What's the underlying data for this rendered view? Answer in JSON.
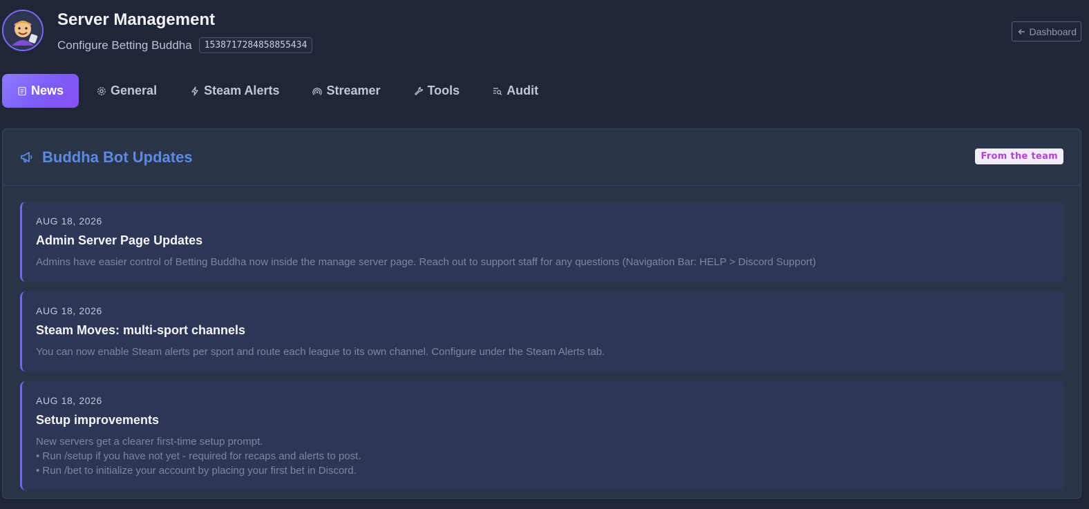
{
  "header": {
    "title": "Server Management",
    "subtitle": "Configure Betting Buddha",
    "server_id": "1538717284858855434",
    "dashboard_label": "Dashboard"
  },
  "tabs": [
    {
      "label": "News",
      "icon": "newspaper-icon",
      "active": true
    },
    {
      "label": "General",
      "icon": "gear-icon",
      "active": false
    },
    {
      "label": "Steam Alerts",
      "icon": "bolt-icon",
      "active": false
    },
    {
      "label": "Streamer",
      "icon": "broadcast-icon",
      "active": false
    },
    {
      "label": "Tools",
      "icon": "wrench-icon",
      "active": false
    },
    {
      "label": "Audit",
      "icon": "list-search-icon",
      "active": false
    }
  ],
  "panel": {
    "title": "Buddha Bot Updates",
    "badge": "From the team",
    "icon": "megaphone-icon"
  },
  "news": [
    {
      "date": "AUG 18, 2026",
      "title": "Admin Server Page Updates",
      "body": [
        "Admins have easier control of Betting Buddha now inside the manage server page. Reach out to support staff for any questions (Navigation Bar: HELP > Discord Support)"
      ]
    },
    {
      "date": "AUG 18, 2026",
      "title": "Steam Moves: multi-sport channels",
      "body": [
        "You can now enable Steam alerts per sport and route each league to its own channel. Configure under the Steam Alerts tab."
      ]
    },
    {
      "date": "AUG 18, 2026",
      "title": "Setup improvements",
      "body": [
        "New servers get a clearer first-time setup prompt.",
        "• Run /setup if you have not yet - required for recaps and alerts to post.",
        "• Run /bet to initialize your account by placing your first bet in Discord."
      ]
    }
  ],
  "colors": {
    "background": "#1f2638",
    "panel": "#2a3448",
    "accent": "#7b5cf7",
    "panel_title": "#5d8ae0",
    "badge_text": "#b83fd8"
  }
}
